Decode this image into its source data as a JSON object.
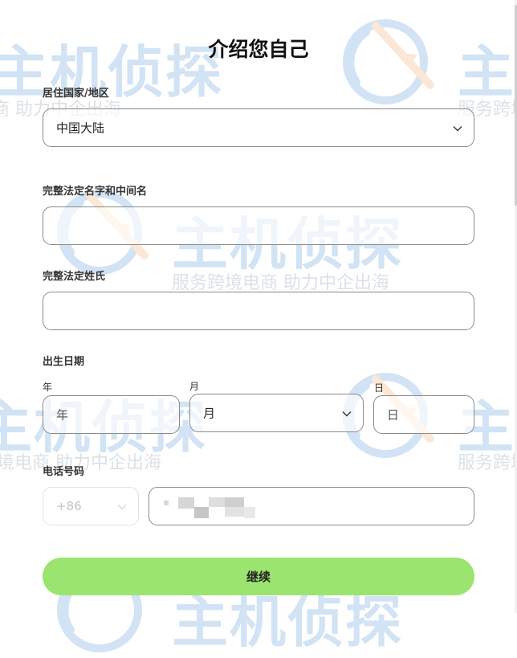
{
  "form": {
    "title": "介绍您自己",
    "country": {
      "label": "居住国家/地区",
      "value": "中国大陆"
    },
    "first_name": {
      "label": "完整法定名字和中间名",
      "value": ""
    },
    "last_name": {
      "label": "完整法定姓氏",
      "value": ""
    },
    "birth_date": {
      "label": "出生日期",
      "year_label": "年",
      "year_placeholder": "年",
      "month_label": "月",
      "month_value": "月",
      "day_label": "日",
      "day_placeholder": "日"
    },
    "phone": {
      "label": "电话号码",
      "country_code": "+86",
      "number": "(redacted)"
    },
    "continue_label": "继续"
  },
  "watermark": {
    "brand": "主机侦探",
    "tagline": "服务跨境电商 助力中企出海"
  },
  "colors": {
    "primary_button": "#9be46f",
    "field_border": "#8a8a8a",
    "disabled_border": "#e2e2e2",
    "watermark_blue": "#6ea6dc",
    "watermark_orange": "#f2b27a"
  },
  "icons": {
    "select_arrow": "chevron-down-icon"
  }
}
